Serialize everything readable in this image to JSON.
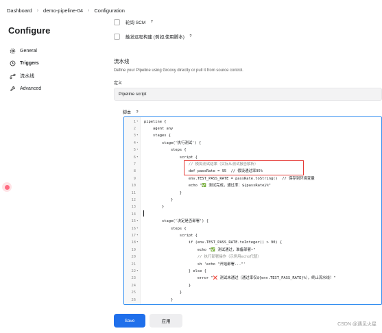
{
  "breadcrumb": {
    "items": [
      "Dashboard",
      "demo-pipeline-04",
      "Configuration"
    ],
    "separator": "›"
  },
  "sidebar": {
    "title": "Configure",
    "items": [
      {
        "label": "General",
        "icon": "gear-icon",
        "active": false
      },
      {
        "label": "Triggers",
        "icon": "clock-icon",
        "active": true
      },
      {
        "label": "流水线",
        "icon": "pipeline-icon",
        "active": false
      },
      {
        "label": "Advanced",
        "icon": "wrench-icon",
        "active": false
      }
    ]
  },
  "triggers": {
    "options": [
      {
        "label": "轮询 SCM",
        "checked": false,
        "help": "?"
      },
      {
        "label": "触发远程构建 (例如,使用脚本)",
        "checked": false,
        "help": "?"
      }
    ]
  },
  "pipeline": {
    "section_title": "流水线",
    "description": "Define your Pipeline using Groovy directly or pull it from source control.",
    "definition_label": "定义",
    "definition_value": "Pipeline script",
    "script_label": "脚本",
    "script_help": "?"
  },
  "editor": {
    "lines": [
      {
        "n": "1",
        "fold": "▾",
        "text": "pipeline {"
      },
      {
        "n": "2",
        "fold": "",
        "text": "    agent any"
      },
      {
        "n": "3",
        "fold": "▾",
        "text": "    stages {"
      },
      {
        "n": "4",
        "fold": "▾",
        "text": "        stage('执行测试') {"
      },
      {
        "n": "5",
        "fold": "▾",
        "text": "            steps {"
      },
      {
        "n": "6",
        "fold": "▾",
        "text": "                script {"
      },
      {
        "n": "7",
        "fold": "",
        "text": "                    // 模拟测试结果（实际从测试报告解析）"
      },
      {
        "n": "8",
        "fold": "",
        "text": "                    def passRate = 95  // 假设通过率95%"
      },
      {
        "n": "9",
        "fold": "",
        "text": "                    env.TEST_PASS_RATE = passRate.toString()  // 保存到环境变量"
      },
      {
        "n": "10",
        "fold": "",
        "text": "                    echo \"✅ 测试完成，通过率：${passRate}%\""
      },
      {
        "n": "11",
        "fold": "",
        "text": "                }"
      },
      {
        "n": "12",
        "fold": "",
        "text": "            }"
      },
      {
        "n": "13",
        "fold": "",
        "text": "        }"
      },
      {
        "n": "14",
        "fold": "",
        "text": ""
      },
      {
        "n": "15",
        "fold": "▾",
        "text": "        stage('决定是否部署') {"
      },
      {
        "n": "16",
        "fold": "▾",
        "text": "            steps {"
      },
      {
        "n": "17",
        "fold": "▾",
        "text": "                script {"
      },
      {
        "n": "18",
        "fold": "▾",
        "text": "                    if (env.TEST_PASS_RATE.toInteger() > 90) {"
      },
      {
        "n": "19",
        "fold": "",
        "text": "                        echo \"✅ 测试通过，准备部署~\""
      },
      {
        "n": "20",
        "fold": "",
        "text": "                        // 执行部署操作（示例用echo代替）"
      },
      {
        "n": "21",
        "fold": "",
        "text": "                        sh 'echo \"开始部署...\"'"
      },
      {
        "n": "22",
        "fold": "▾",
        "text": "                    } else {"
      },
      {
        "n": "23",
        "fold": "",
        "text": "                        error \"❌ 测试未通过（通过率仅${env.TEST_PASS_RATE}%），终止流水线！\""
      },
      {
        "n": "24",
        "fold": "",
        "text": "                    }"
      },
      {
        "n": "25",
        "fold": "",
        "text": "                }"
      },
      {
        "n": "26",
        "fold": "",
        "text": "            }"
      }
    ]
  },
  "actions": {
    "save_label": "Save",
    "apply_label": "应用"
  },
  "watermark": "CSDN @遇见火星",
  "colors": {
    "primary": "#1f6feb",
    "editor_border": "#2f8cf0",
    "highlight": "#e53935"
  }
}
